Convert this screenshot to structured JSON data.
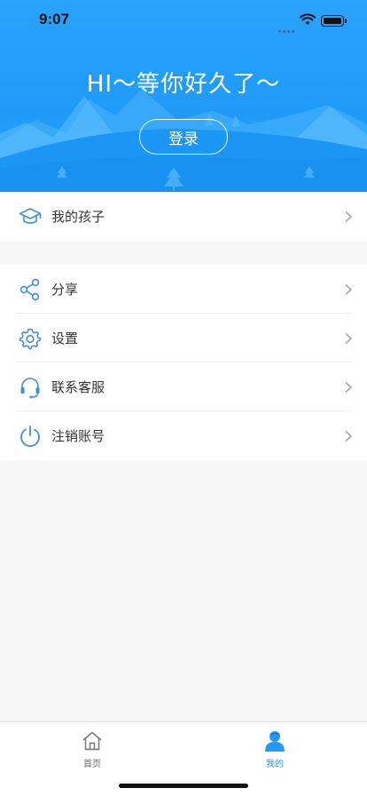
{
  "status_bar": {
    "time": "9:07"
  },
  "hero": {
    "greeting": "HI～等你好久了～",
    "login_button": "登录"
  },
  "menu_group_1": [
    {
      "label": "我的孩子",
      "icon": "graduation-cap-icon"
    }
  ],
  "menu_group_2": [
    {
      "label": "分享",
      "icon": "share-icon"
    },
    {
      "label": "设置",
      "icon": "gear-icon"
    },
    {
      "label": "联系客服",
      "icon": "headset-icon"
    },
    {
      "label": "注销账号",
      "icon": "power-icon"
    }
  ],
  "tab_bar": {
    "tabs": [
      {
        "label": "首页",
        "icon": "home-icon",
        "active": false
      },
      {
        "label": "我的",
        "icon": "user-icon",
        "active": true
      }
    ]
  },
  "colors": {
    "accent": "#1f9af8",
    "icon_blue": "#3d8fe0",
    "text": "#333333",
    "tab_inactive": "#666666",
    "tab_active": "#1f9af8"
  }
}
